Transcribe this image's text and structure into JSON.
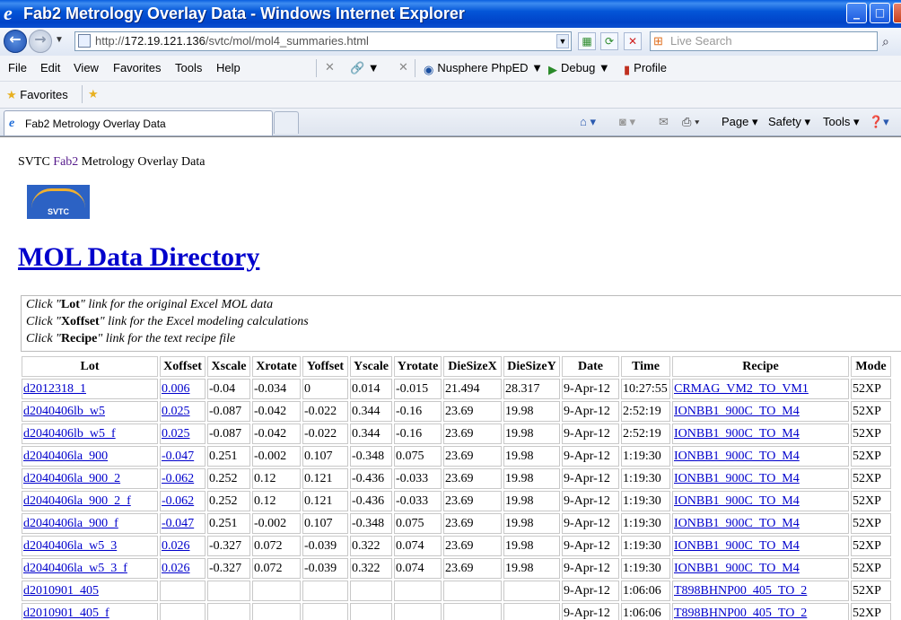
{
  "window": {
    "title": "Fab2 Metrology Overlay Data - Windows Internet Explorer",
    "icon": "ie-logo-icon",
    "controls": {
      "minimize": "_",
      "maximize": "□",
      "close": "✕"
    }
  },
  "address_bar": {
    "url_prefix": "http://",
    "url_host": "172.19.121.136",
    "url_path": "/svtc/mol/mol4_summaries.html",
    "search_placeholder": "Live Search"
  },
  "menu": {
    "items": [
      "File",
      "Edit",
      "View",
      "Favorites",
      "Tools",
      "Help"
    ]
  },
  "toolbar": {
    "nusphere": "Nusphere PhpED",
    "debug": "Debug",
    "profile": "Profile"
  },
  "favorites_bar": {
    "label": "Favorites"
  },
  "tabs": {
    "active": "Fab2 Metrology Overlay Data"
  },
  "command_bar": {
    "page": "Page",
    "safety": "Safety",
    "tools": "Tools"
  },
  "page": {
    "header_prefix": "SVTC ",
    "header_link": "Fab2",
    "header_suffix": " Metrology Overlay Data",
    "logo_text": "SVTC",
    "heading": "MOL Data Directory",
    "notes": [
      {
        "pre": "Click \"",
        "bold": "Lot",
        "post": "\" link for the original Excel MOL data"
      },
      {
        "pre": "Click \"",
        "bold": "Xoffset",
        "post": "\" link for the Excel modeling calculations"
      },
      {
        "pre": "Click \"",
        "bold": "Recipe",
        "post": "\" link for the text recipe file"
      }
    ],
    "table": {
      "headers": [
        "Lot",
        "Xoffset",
        "Xscale",
        "Xrotate",
        "Yoffset",
        "Yscale",
        "Yrotate",
        "DieSizeX",
        "DieSizeY",
        "Date",
        "Time",
        "Recipe",
        "Mode"
      ],
      "rows": [
        [
          "d2012318_1",
          "0.006",
          "-0.04",
          "-0.034",
          "0",
          "0.014",
          "-0.015",
          "21.494",
          "28.317",
          "9-Apr-12",
          "10:27:55",
          "CRMAG_VM2_TO_VM1",
          "52XP"
        ],
        [
          "d2040406lb_w5",
          "0.025",
          "-0.087",
          "-0.042",
          "-0.022",
          "0.344",
          "-0.16",
          "23.69",
          "19.98",
          "9-Apr-12",
          "2:52:19",
          "IONBB1_900C_TO_M4",
          "52XP"
        ],
        [
          "d2040406lb_w5_f",
          "0.025",
          "-0.087",
          "-0.042",
          "-0.022",
          "0.344",
          "-0.16",
          "23.69",
          "19.98",
          "9-Apr-12",
          "2:52:19",
          "IONBB1_900C_TO_M4",
          "52XP"
        ],
        [
          "d2040406la_900",
          "-0.047",
          "0.251",
          "-0.002",
          "0.107",
          "-0.348",
          "0.075",
          "23.69",
          "19.98",
          "9-Apr-12",
          "1:19:30",
          "IONBB1_900C_TO_M4",
          "52XP"
        ],
        [
          "d2040406la_900_2",
          "-0.062",
          "0.252",
          "0.12",
          "0.121",
          "-0.436",
          "-0.033",
          "23.69",
          "19.98",
          "9-Apr-12",
          "1:19:30",
          "IONBB1_900C_TO_M4",
          "52XP"
        ],
        [
          "d2040406la_900_2_f",
          "-0.062",
          "0.252",
          "0.12",
          "0.121",
          "-0.436",
          "-0.033",
          "23.69",
          "19.98",
          "9-Apr-12",
          "1:19:30",
          "IONBB1_900C_TO_M4",
          "52XP"
        ],
        [
          "d2040406la_900_f",
          "-0.047",
          "0.251",
          "-0.002",
          "0.107",
          "-0.348",
          "0.075",
          "23.69",
          "19.98",
          "9-Apr-12",
          "1:19:30",
          "IONBB1_900C_TO_M4",
          "52XP"
        ],
        [
          "d2040406la_w5_3",
          "0.026",
          "-0.327",
          "0.072",
          "-0.039",
          "0.322",
          "0.074",
          "23.69",
          "19.98",
          "9-Apr-12",
          "1:19:30",
          "IONBB1_900C_TO_M4",
          "52XP"
        ],
        [
          "d2040406la_w5_3_f",
          "0.026",
          "-0.327",
          "0.072",
          "-0.039",
          "0.322",
          "0.074",
          "23.69",
          "19.98",
          "9-Apr-12",
          "1:19:30",
          "IONBB1_900C_TO_M4",
          "52XP"
        ],
        [
          "d2010901_405",
          "",
          "",
          "",
          "",
          "",
          "",
          "",
          "",
          "9-Apr-12",
          "1:06:06",
          "T898BHNP00_405_TO_2",
          "52XP"
        ],
        [
          "d2010901_405_f",
          "",
          "",
          "",
          "",
          "",
          "",
          "",
          "",
          "9-Apr-12",
          "1:06:06",
          "T898BHNP00_405_TO_2",
          "52XP"
        ]
      ]
    }
  }
}
